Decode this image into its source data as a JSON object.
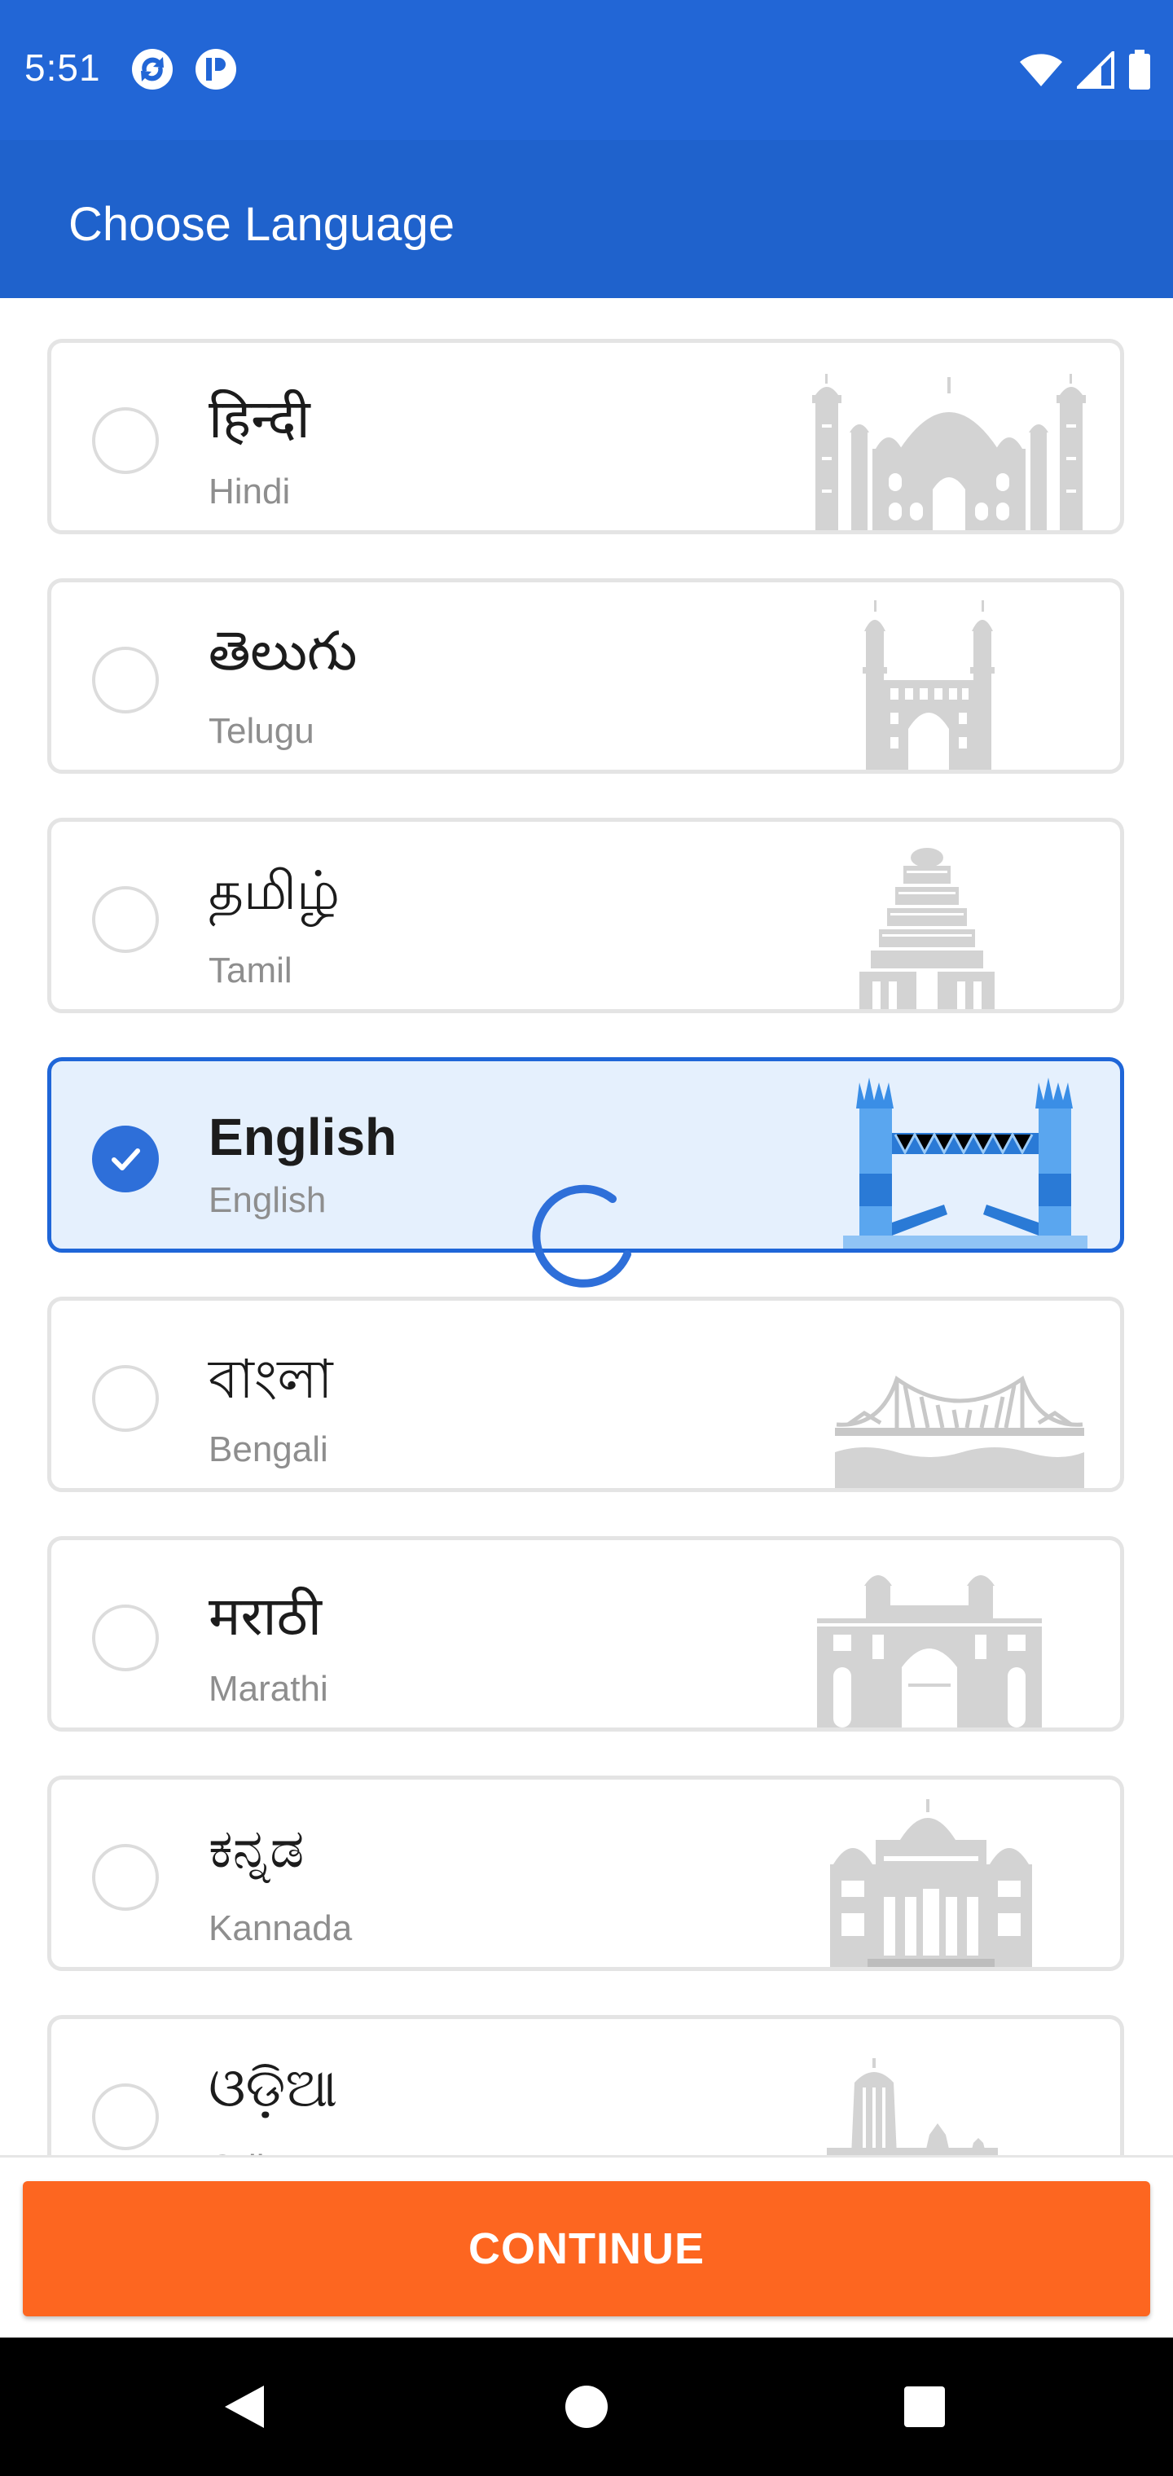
{
  "status_bar": {
    "time": "5:51",
    "left_icons": [
      "sync-app-icon",
      "p-app-icon"
    ],
    "right_icons": [
      "wifi-icon",
      "cellular-signal-icon",
      "battery-icon"
    ]
  },
  "app_bar": {
    "title": "Choose Language"
  },
  "languages": [
    {
      "native": "हिन्दी",
      "english": "Hindi",
      "selected": false,
      "landmark": "taj-mahal-icon"
    },
    {
      "native": "తెలుగు",
      "english": "Telugu",
      "selected": false,
      "landmark": "charminar-icon"
    },
    {
      "native": "தமிழ்",
      "english": "Tamil",
      "selected": false,
      "landmark": "temple-gopuram-icon"
    },
    {
      "native": "English",
      "english": "English",
      "selected": true,
      "landmark": "tower-bridge-icon"
    },
    {
      "native": "বাংলা",
      "english": "Bengali",
      "selected": false,
      "landmark": "howrah-bridge-icon"
    },
    {
      "native": "मराठी",
      "english": "Marathi",
      "selected": false,
      "landmark": "gateway-of-india-icon"
    },
    {
      "native": "ಕನ್ನಡ",
      "english": "Kannada",
      "selected": false,
      "landmark": "mysore-palace-icon"
    },
    {
      "native": "ଓଡ଼ିଆ",
      "english": "Odia",
      "selected": false,
      "landmark": "konark-temple-icon"
    }
  ],
  "continue_label": "CONTINUE",
  "colors": {
    "status_bar": "#2266d6",
    "app_bar": "#1f62cc",
    "selected_border": "#1f66d8",
    "selected_bg": "#e5f0fd",
    "accent": "#2e6fd9",
    "continue_button": "#fd6620"
  },
  "nav_bar": {
    "buttons": [
      "back-icon",
      "home-icon",
      "recents-icon"
    ]
  }
}
